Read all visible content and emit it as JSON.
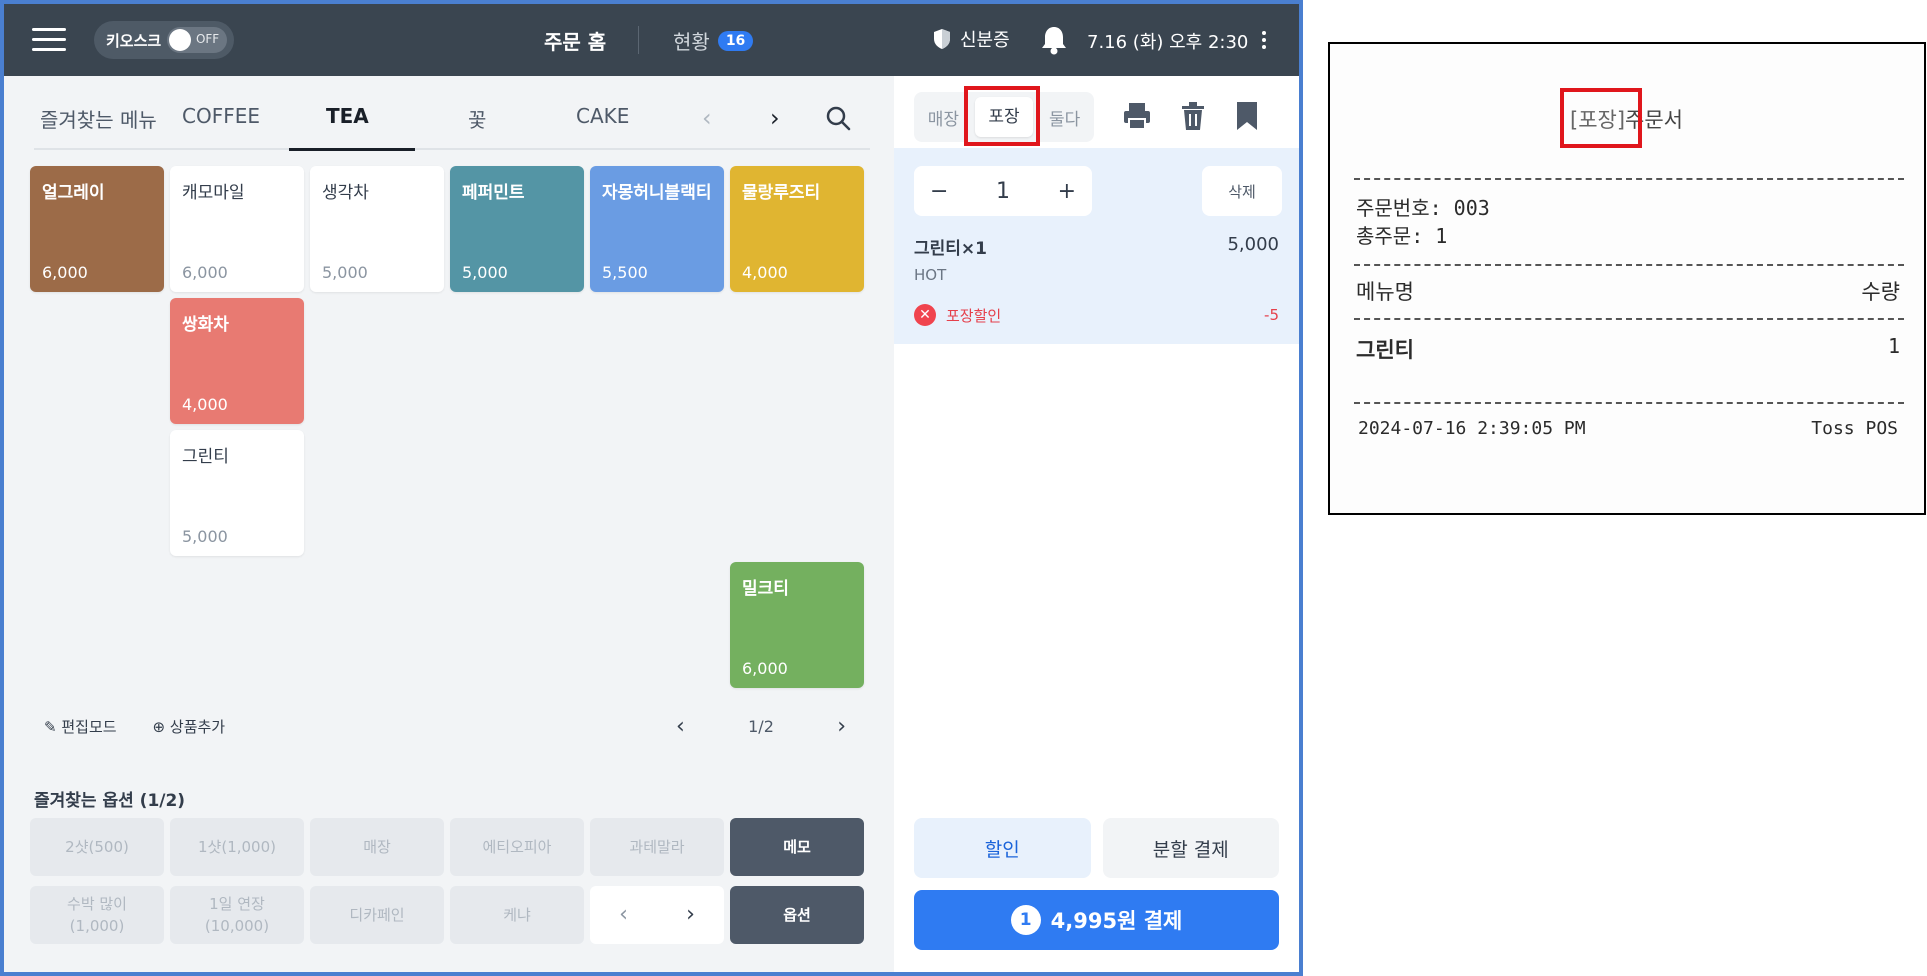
{
  "topbar": {
    "kiosk_label": "키오스크",
    "kiosk_toggle": "OFF",
    "title": "주문 홈",
    "status_label": "현황",
    "status_count": "16",
    "id_label": "신분증",
    "datetime": "7.16 (화) 오후 2:30"
  },
  "categories": {
    "items": [
      "즐겨찾는 메뉴",
      "COFFEE",
      "TEA",
      "꽃",
      "CAKE"
    ],
    "active": "TEA"
  },
  "menu_tiles": [
    {
      "name": "얼그레이",
      "price": "6,000",
      "color": "#9c6b48"
    },
    {
      "name": "캐모마일",
      "price": "6,000",
      "color": "#ffffff"
    },
    {
      "name": "생각차",
      "price": "5,000",
      "color": "#ffffff"
    },
    {
      "name": "페퍼민트",
      "price": "5,000",
      "color": "#5495a5"
    },
    {
      "name": "자몽허니블랙티",
      "price": "5,500",
      "color": "#6a9ce3"
    },
    {
      "name": "물랑루즈티",
      "price": "4,000",
      "color": "#e0b531"
    },
    {
      "name": "쌍화차",
      "price": "4,000",
      "color": "#e87a72"
    },
    {
      "name": "그린티",
      "price": "5,000",
      "color": "#ffffff"
    },
    {
      "name": "밀크티",
      "price": "6,000",
      "color": "#74b05f"
    }
  ],
  "menu_footer": {
    "edit_mode": "편집모드",
    "add_item": "상품추가",
    "page": "1/2"
  },
  "options": {
    "title": "즐겨찾는 옵션 (1/2)",
    "row1": [
      "2샷(500)",
      "1샷(1,000)",
      "매장",
      "에티오피아",
      "과테말라",
      "메모"
    ],
    "row2_a": "수박 많이",
    "row2_a2": "(1,000)",
    "row2_b": "1일 연장",
    "row2_b2": "(10,000)",
    "row2_c": "디카페인",
    "row2_d": "케냐",
    "row2_f": "옵션"
  },
  "order_panel": {
    "modes": [
      "매장",
      "포장",
      "둘다"
    ],
    "active_mode": "포장",
    "quantity": "1",
    "delete_label": "삭제",
    "item_name": "그린티×1",
    "item_price": "5,000",
    "item_option": "HOT",
    "discount_label": "포장할인",
    "discount_amount": "-5",
    "discount_button": "할인",
    "split_button": "분할 결제",
    "pay_count": "1",
    "pay_label": "4,995원 결제"
  },
  "receipt": {
    "tag": "[포장]",
    "title": "주문서",
    "order_no": "주문번호: 003",
    "total_orders": "총주문: 1",
    "col_menu": "메뉴명",
    "col_qty": "수량",
    "item": "그린티",
    "qty": "1",
    "timestamp": "2024-07-16 2:39:05 PM",
    "brand": "Toss POS"
  },
  "colors": {
    "topbar": "#3a4550",
    "accent": "#2f7bf2",
    "highlight": "#e0161c"
  }
}
